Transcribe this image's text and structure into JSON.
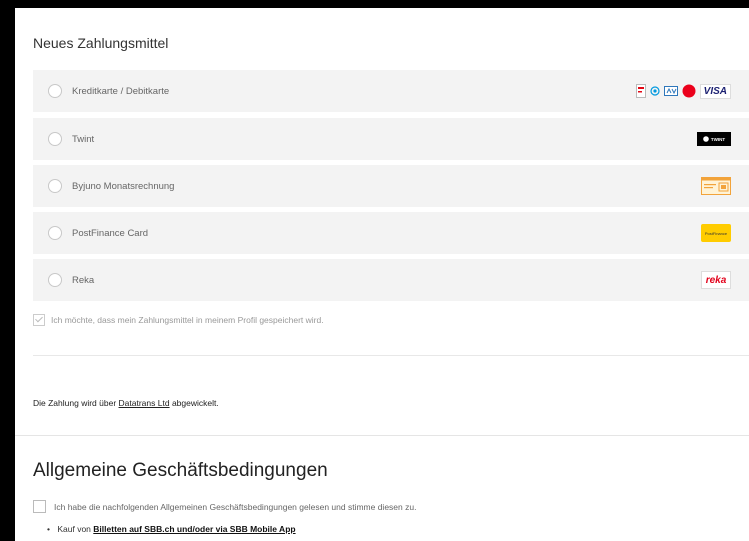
{
  "payment": {
    "title": "Neues Zahlungsmittel",
    "options": [
      {
        "label": "Kreditkarte / Debitkarte",
        "logos": [
          "postcard-icon",
          "maestro-icon",
          "amex-icon",
          "mastercard-icon",
          "visa-icon"
        ],
        "visa_text": "VISA"
      },
      {
        "label": "Twint",
        "logo_text": "TWINT"
      },
      {
        "label": "Byjuno Monatsrechnung"
      },
      {
        "label": "PostFinance Card",
        "logo_text": "PostFinance"
      },
      {
        "label": "Reka",
        "logo_text": "reka"
      }
    ],
    "save_label": "Ich möchte, dass mein Zahlungsmittel in meinem Profil gespeichert wird.",
    "save_checked": true
  },
  "processor": {
    "prefix": "Die Zahlung wird über",
    "link": "Datatrans Ltd",
    "suffix": "abgewickelt."
  },
  "agb": {
    "title": "Allgemeine Geschäftsbedingungen",
    "accept_label": "Ich habe die nachfolgenden Allgemeinen Geschäftsbedingungen gelesen und stimme diesen zu.",
    "accept_checked": false,
    "items": [
      {
        "prefix": "Kauf von",
        "link": "Billetten auf SBB.ch und/oder via SBB Mobile App"
      }
    ]
  },
  "colors": {
    "option_bg": "#f3f3f3",
    "visa_blue": "#1a1f71",
    "mastercard_red": "#eb001b",
    "twint_black": "#000000",
    "postfinance_yellow": "#ffcc00",
    "reka_red": "#e2001a"
  }
}
